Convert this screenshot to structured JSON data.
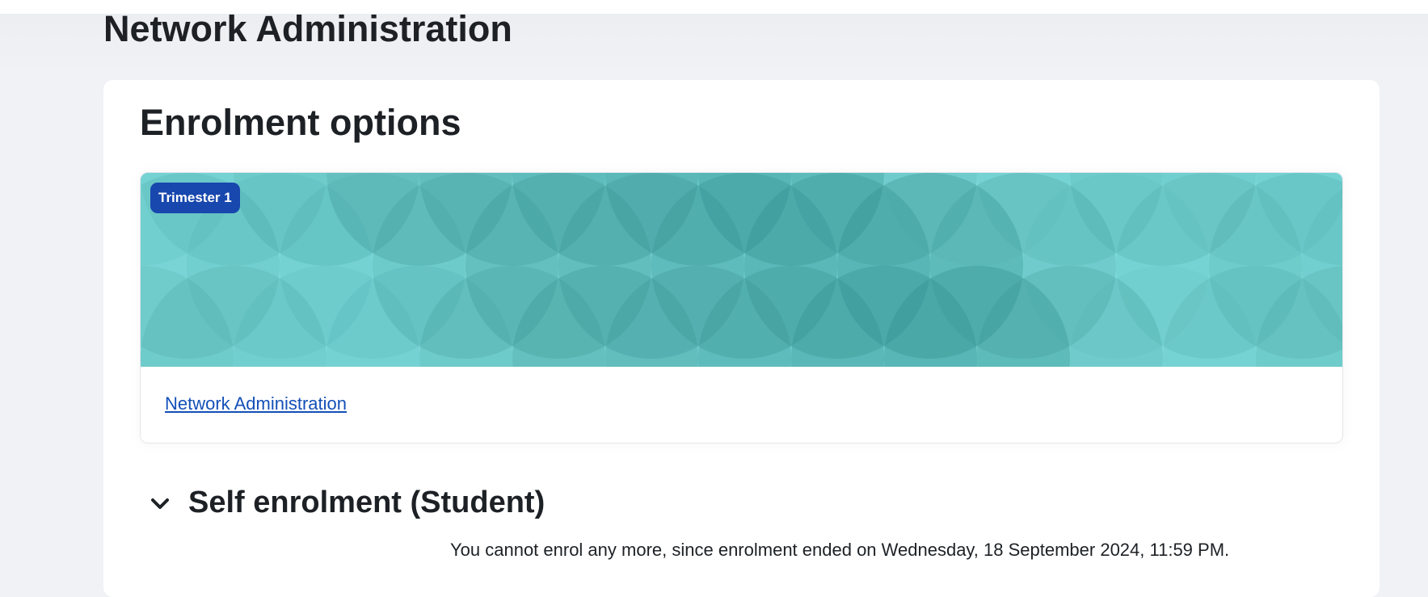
{
  "page": {
    "title": "Network Administration"
  },
  "enrolment": {
    "heading": "Enrolment options",
    "course_card": {
      "badge": "Trimester 1",
      "course_link": "Network Administration",
      "image_colors": {
        "base": "#86e2e3",
        "circle": "#2c8a87"
      }
    },
    "method": {
      "toggle_icon": "chevron-down-icon",
      "title": "Self enrolment (Student)",
      "message": "You cannot enrol any more, since enrolment ended on Wednesday, 18 September 2024, 11:59 PM."
    }
  },
  "colors": {
    "page_background": "#f1f2f5",
    "card_background": "#ffffff",
    "badge_background": "#1847ae",
    "link": "#1350b8",
    "text": "#1d2125"
  }
}
